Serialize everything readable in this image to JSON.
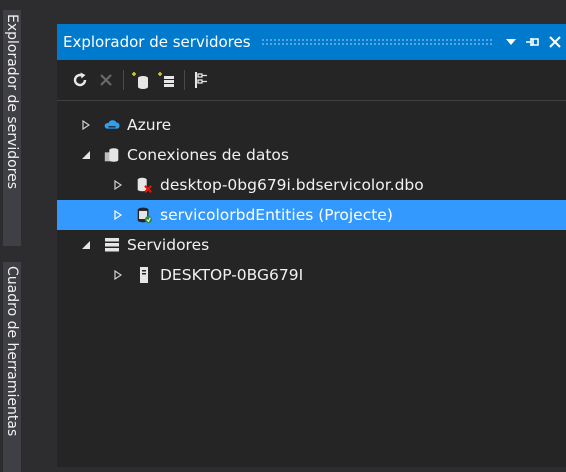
{
  "side_tabs": [
    {
      "label": "Explorador de servidores"
    },
    {
      "label": "Cuadro de herramientas"
    }
  ],
  "panel": {
    "title": "Explorador de servidores",
    "accent": "#007acc",
    "selection_color": "#3399ff"
  },
  "toolbar": {
    "items": [
      "refresh-icon",
      "stop-icon",
      "connect-database-icon",
      "connect-server-icon",
      "properties-icon"
    ]
  },
  "tree": {
    "azure": "Azure",
    "connections": "Conexiones de datos",
    "conn1": "desktop-0bg679i.bdservicolor.dbo",
    "conn2": "servicolorbdEntities (Projecte)",
    "servers": "Servidores",
    "server1": "DESKTOP-0BG679I"
  }
}
